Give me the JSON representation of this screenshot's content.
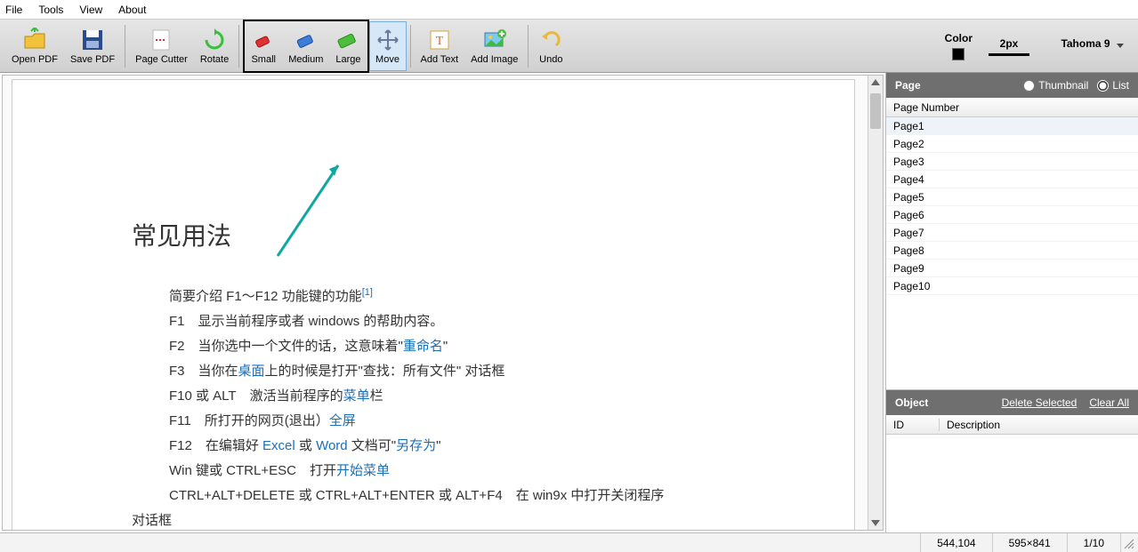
{
  "menu": {
    "file": "File",
    "tools": "Tools",
    "view": "View",
    "about": "About"
  },
  "toolbar": {
    "open_pdf": "Open PDF",
    "save_pdf": "Save PDF",
    "page_cutter": "Page Cutter",
    "rotate": "Rotate",
    "small": "Small",
    "medium": "Medium",
    "large": "Large",
    "move": "Move",
    "add_text": "Add Text",
    "add_image": "Add Image",
    "undo": "Undo"
  },
  "toolbar_right": {
    "color_label": "Color",
    "stroke_label": "2px",
    "font_label": "Tahoma 9"
  },
  "document": {
    "title": "常见用法",
    "intro_prefix": "简要介绍 F1～F12 功能键的功能",
    "intro_ref": "[1]",
    "rows": [
      {
        "key": "F1",
        "html": "显示当前程序或者 windows 的帮助内容。"
      },
      {
        "key": "F2",
        "html": "当你选中一个文件的话，这意味着\"<a>重命名</a>\""
      },
      {
        "key": "F3",
        "html": "当你在<a>桌面</a>上的时候是打开\"查找：所有文件\" 对话框"
      },
      {
        "key": "F10 或 ALT",
        "html": "激活当前程序的<a>菜单</a>栏"
      },
      {
        "key": "F11",
        "html": "所打开的网页(退出）<a>全屏</a>"
      },
      {
        "key": "F12",
        "html": "在编辑好 <a>Excel</a> 或 <a>Word</a> 文档可\"<a>另存为</a>\""
      },
      {
        "key": "Win 键或 CTRL+ESC",
        "html": "打开<a>开始菜单</a>"
      },
      {
        "key": "",
        "html": "CTRL+ALT+DELETE 或 CTRL+ALT+ENTER 或 ALT+F4　在 win9x 中打开关闭程序"
      }
    ],
    "trail": "对话框"
  },
  "page_panel": {
    "title": "Page",
    "thumbnail": "Thumbnail",
    "list": "List",
    "col_header": "Page Number",
    "items": [
      "Page1",
      "Page2",
      "Page3",
      "Page4",
      "Page5",
      "Page6",
      "Page7",
      "Page8",
      "Page9",
      "Page10"
    ]
  },
  "object_panel": {
    "title": "Object",
    "delete_selected": "Delete Selected",
    "clear_all": "Clear All",
    "col_id": "ID",
    "col_desc": "Description"
  },
  "status": {
    "coords": "544,104",
    "dims": "595×841",
    "page": "1/10"
  }
}
